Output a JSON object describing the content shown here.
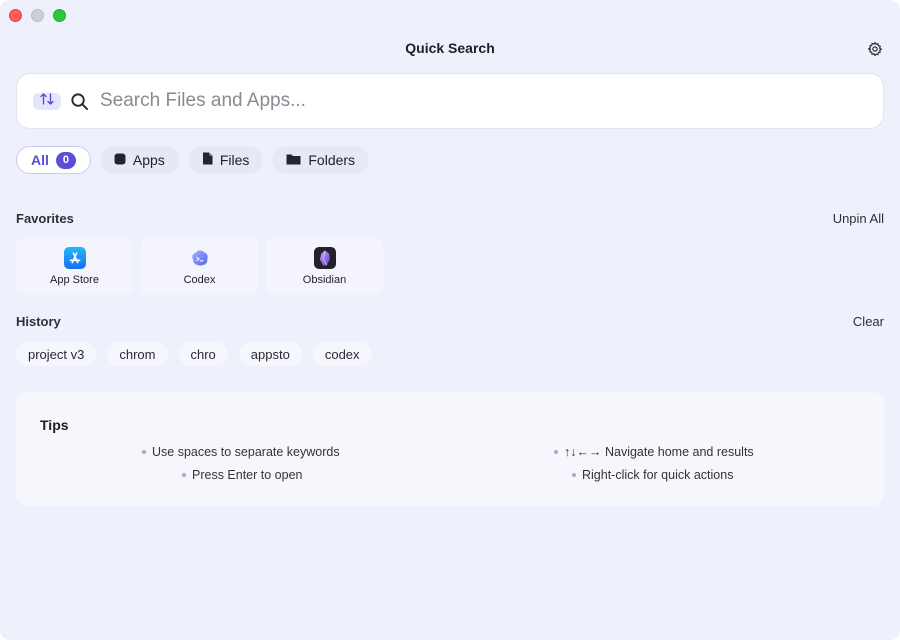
{
  "window": {
    "title": "Quick Search"
  },
  "search": {
    "placeholder": "Search Files and Apps...",
    "value": ""
  },
  "filters": [
    {
      "label": "All",
      "count": "0",
      "active": true
    },
    {
      "label": "Apps"
    },
    {
      "label": "Files"
    },
    {
      "label": "Folders"
    }
  ],
  "favorites": {
    "title": "Favorites",
    "action": "Unpin All",
    "items": [
      {
        "label": "App Store",
        "icon": "app-store-icon",
        "color": "#1e8bf5"
      },
      {
        "label": "Codex",
        "icon": "codex-icon",
        "color": "#6e7cf2"
      },
      {
        "label": "Obsidian",
        "icon": "obsidian-icon",
        "color": "#7b5cd6"
      }
    ]
  },
  "history": {
    "title": "History",
    "action": "Clear",
    "items": [
      "project v3",
      "chrom",
      "chro",
      "appsto",
      "codex"
    ]
  },
  "tips": {
    "title": "Tips",
    "items": [
      "Use spaces to separate keywords",
      "Press Enter to open",
      "↑↓←→ Navigate home and results",
      "Right-click for quick actions"
    ]
  },
  "colors": {
    "accent": "#5b4fd8",
    "background": "#eef0fb"
  }
}
